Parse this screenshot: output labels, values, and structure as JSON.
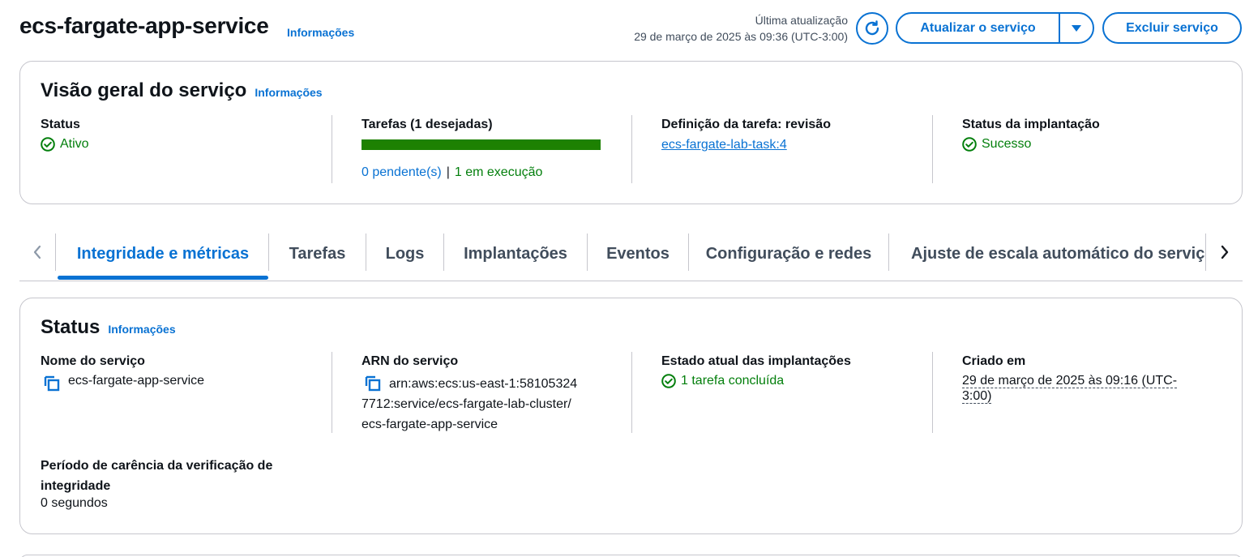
{
  "header": {
    "title": "ecs-fargate-app-service",
    "info": "Informações",
    "last_update_label": "Última atualização",
    "last_update_value": "29 de março de 2025 às 09:36 (UTC-3:00)",
    "update_button": "Atualizar o serviço",
    "delete_button": "Excluir serviço"
  },
  "overview": {
    "title": "Visão geral do serviço",
    "info": "Informações",
    "status_label": "Status",
    "status_value": "Ativo",
    "tasks_label": "Tarefas (1 desejadas)",
    "tasks_progress": 1.0,
    "pending_link": "0 pendente(s)",
    "separator": "|",
    "running_link": "1 em execução",
    "taskdef_label": "Definição da tarefa: revisão",
    "taskdef_link": "ecs-fargate-lab-task:4",
    "deploy_label": "Status da implantação",
    "deploy_value": "Sucesso"
  },
  "tabs": [
    {
      "label": "Integridade e métricas",
      "active": true
    },
    {
      "label": "Tarefas"
    },
    {
      "label": "Logs"
    },
    {
      "label": "Implantações"
    },
    {
      "label": "Eventos"
    },
    {
      "label": "Configuração e redes"
    },
    {
      "label": "Ajuste de escala automático do serviço"
    }
  ],
  "status": {
    "title": "Status",
    "info": "Informações",
    "service_name_label": "Nome do serviço",
    "service_name_value": "ecs-fargate-app-service",
    "arn_label": "ARN do serviço",
    "arn_line1": "arn:aws:ecs:us-east-1:58105324",
    "arn_line2": "7712:service/ecs-fargate-lab-cluster/",
    "arn_line3": "ecs-fargate-app-service",
    "deploy_state_label": "Estado atual das implantações",
    "deploy_state_value": "1 tarefa concluída",
    "created_label": "Criado em",
    "created_line1": "29 de março de 2025 às 09:16 (UTC-",
    "created_line2": "3:00)",
    "grace_label_line1": "Período de carência da verificação de",
    "grace_label_line2": "integridade",
    "grace_value": "0 segundos"
  },
  "colors": {
    "accent": "#0972d3",
    "success": "#037f0c",
    "progress": "#1d8102",
    "border": "#c6c6cd"
  }
}
